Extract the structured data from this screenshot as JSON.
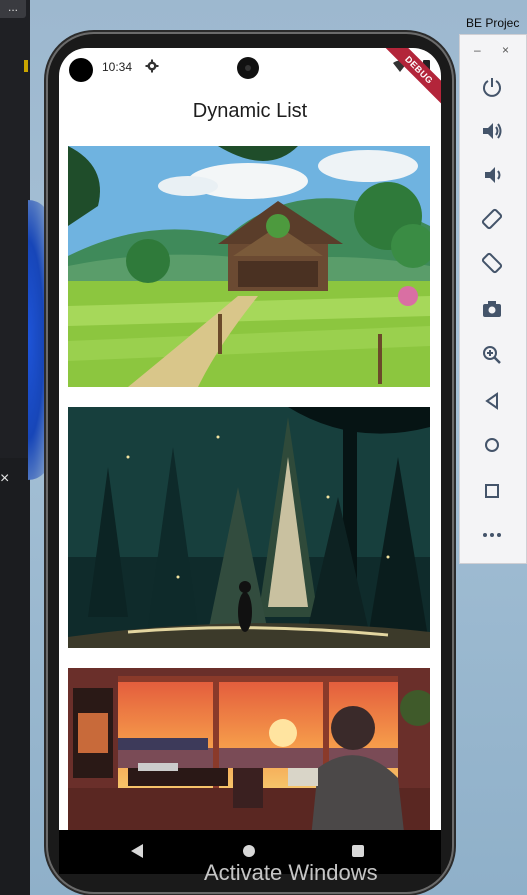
{
  "host": {
    "ide_button_label": "...",
    "ide_close_label": "×",
    "window_title": "BE Projec",
    "watermark": "Activate Windows"
  },
  "status_bar": {
    "time": "10:34",
    "debug_banner": "DEBUG"
  },
  "app": {
    "title": "Dynamic List",
    "items": [
      {
        "name": "farmhouse-landscape-image"
      },
      {
        "name": "night-forest-image"
      },
      {
        "name": "sunset-room-image"
      }
    ]
  },
  "emulator_toolbar": {
    "minimize": "–",
    "close": "×",
    "buttons": [
      "power-icon",
      "volume-up-icon",
      "volume-down-icon",
      "rotate-left-icon",
      "rotate-right-icon",
      "screenshot-icon",
      "zoom-icon",
      "back-icon",
      "home-icon",
      "overview-icon",
      "more-icon"
    ]
  },
  "colors": {
    "debug_ribbon": "#b3253a",
    "navbar": "#000000",
    "app_background": "#ffffff"
  }
}
